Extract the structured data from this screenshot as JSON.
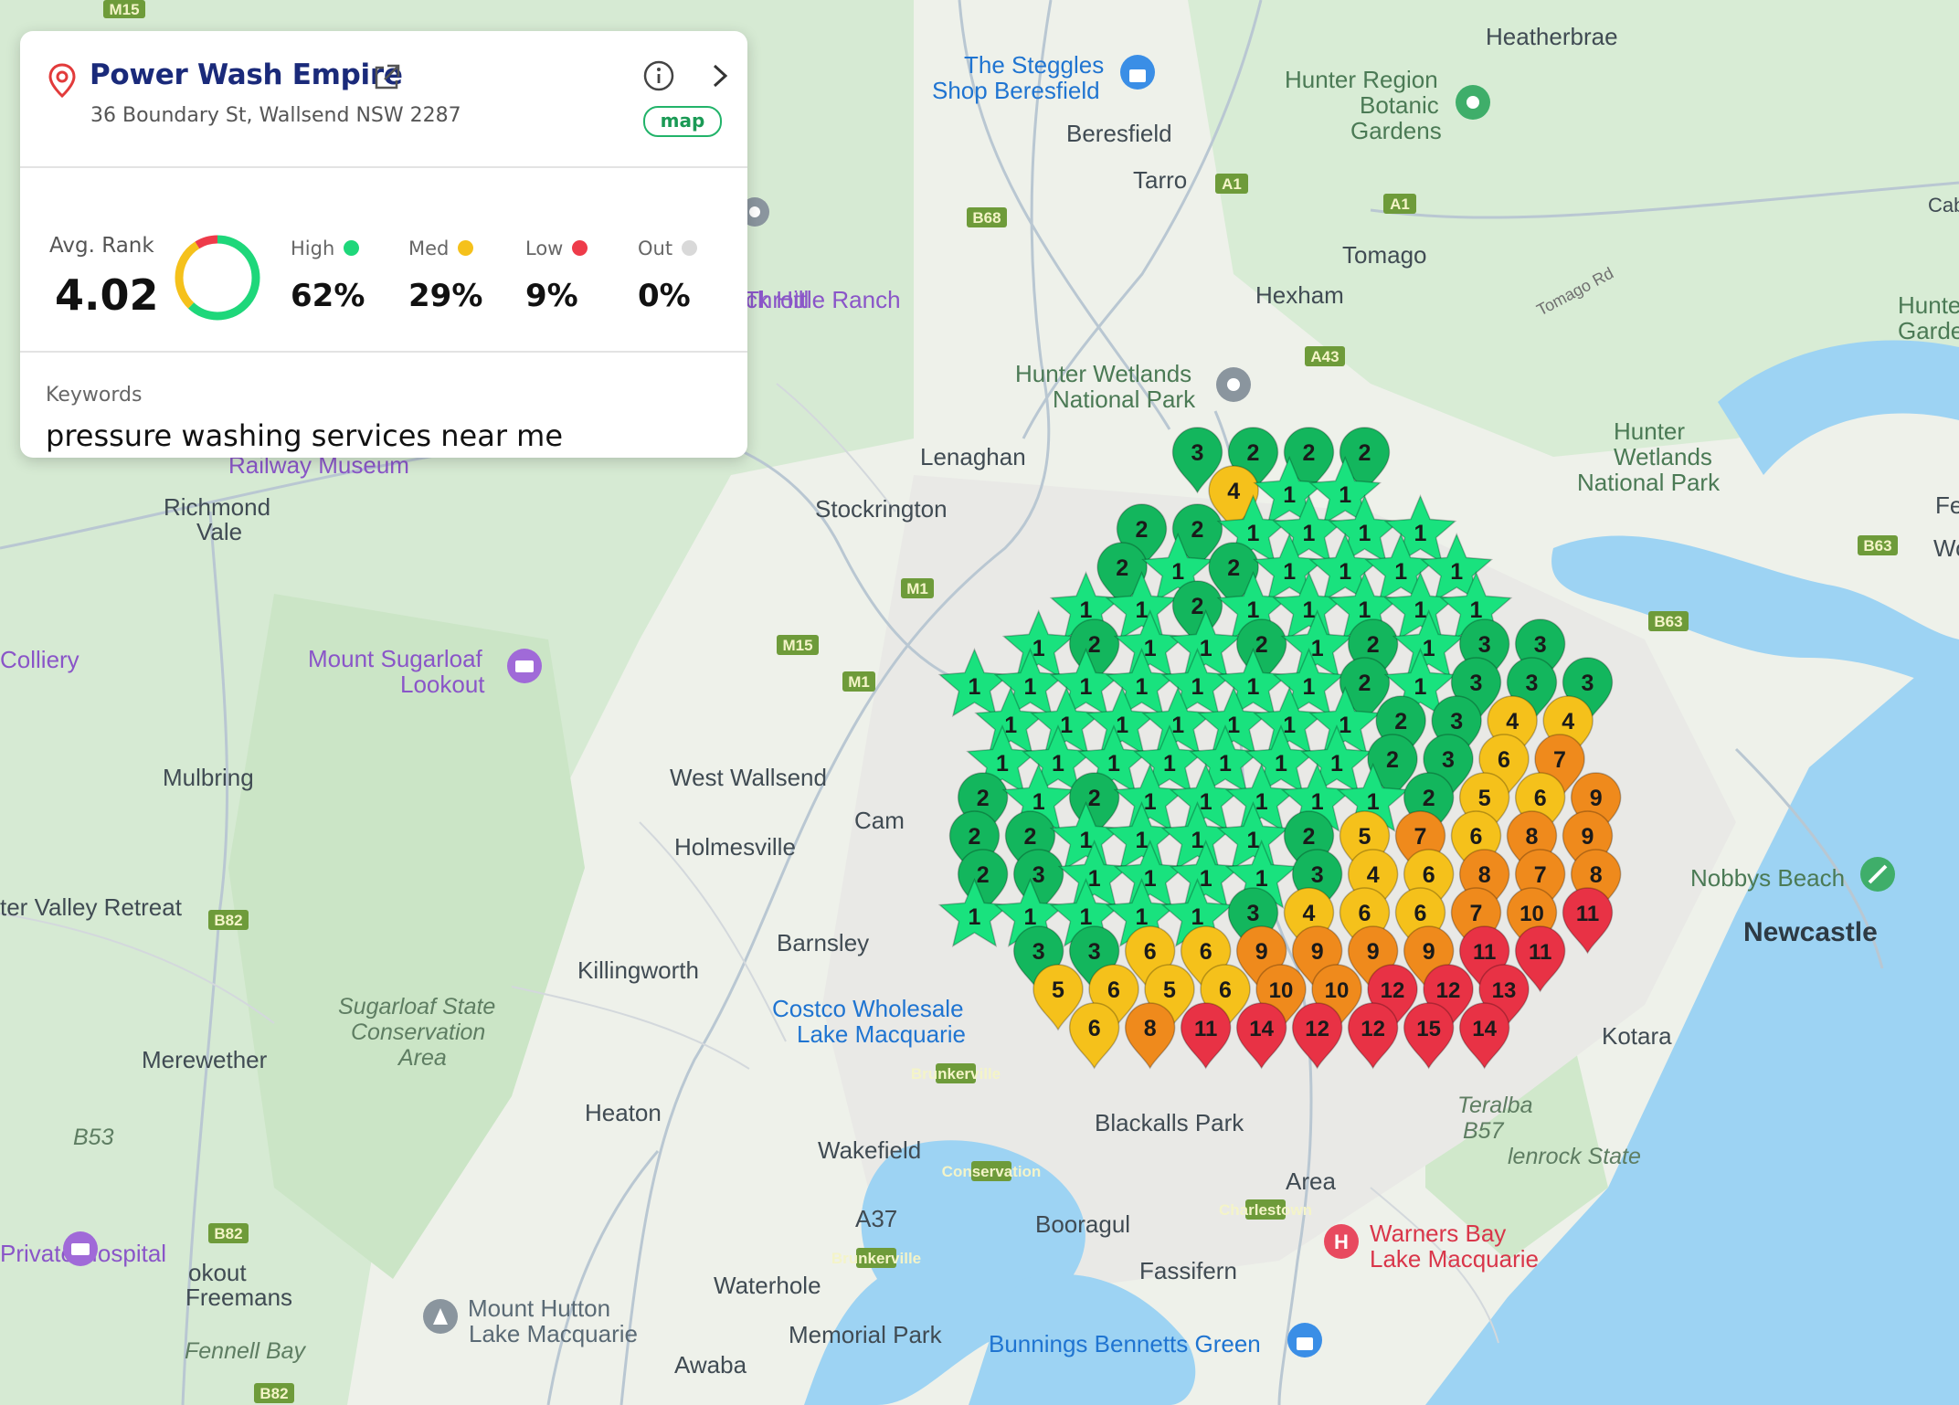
{
  "card": {
    "business_name": "Power Wash Empire",
    "address": "36 Boundary St, Wallsend NSW 2287",
    "map_badge": "map",
    "avg_rank_label": "Avg. Rank",
    "avg_rank_value": "4.02",
    "stats": [
      {
        "label": "High",
        "value": "62%",
        "color": "#1ed77a",
        "fraction": 0.62
      },
      {
        "label": "Med",
        "value": "29%",
        "color": "#f5c11b",
        "fraction": 0.29
      },
      {
        "label": "Low",
        "value": "9%",
        "color": "#ee3b4a",
        "fraction": 0.09
      },
      {
        "label": "Out",
        "value": "0%",
        "color": "#d9d9d9",
        "fraction": 0.0
      }
    ],
    "keywords_label": "Keywords",
    "keywords_value": "pressure washing services near me",
    "icons": [
      "location-pin-icon",
      "external-link-icon",
      "info-icon",
      "chevron-right-icon"
    ]
  },
  "map": {
    "places": [
      "M15",
      "The Steggles",
      "Shop Beresfield",
      "Heatherbrae",
      "Hunter Region",
      "Botanic",
      "Gardens",
      "Beresfield",
      "Tarro",
      "A1",
      "B68",
      "Cabbag",
      "Tomago",
      "Tomago Rd",
      "Hunte",
      "Garde",
      "ck Hill",
      "Throttle Ranch",
      "Hexham",
      "A43",
      "Hunter Wetlands",
      "National Park",
      "Lenaghan",
      "Railway Museum",
      "Richmond",
      "Vale",
      "Stockrington",
      "Hunter",
      "Wetlands",
      "National Park",
      "Fe",
      "Wo",
      "B63",
      "M1",
      "Colliery",
      "Mount Sugarloaf",
      "Lookout",
      "Mulbring",
      "West Wallsend",
      "Cam",
      "Holmesville",
      "Nobbys Beach",
      "Newcastle",
      "ter Valley Retreat",
      "B82",
      "Barnsley",
      "Killingworth",
      "Sugarloaf State",
      "Conservation",
      "Area",
      "Costco Wholesale",
      "Lake Macquarie",
      "Kotara",
      "Merewether",
      "Brunkerville",
      "B53",
      "Heaton",
      "Wakefield",
      "Teralba",
      "B57",
      "lenrock State",
      "Conservation",
      "Area",
      "Charlestown",
      "A37",
      "Booragul",
      "Warners Bay",
      "Lake Macquarie",
      "Private Hospital",
      "okout",
      "Freemans",
      "Waterhole",
      "Fassifern",
      "Mount Hutton",
      "Lake Macquarie",
      "Memorial Park",
      "Fennell Bay",
      "Bunnings Bennetts Green",
      "Awaba",
      "Blackalls Park",
      "Cha"
    ]
  },
  "chart_data": {
    "type": "map-grid",
    "legend": [
      {
        "label": "High",
        "color": "#1ed77a"
      },
      {
        "label": "Med",
        "color": "#f5c11b"
      },
      {
        "label": "Low",
        "color": "#ee3b4a"
      },
      {
        "label": "Out",
        "color": "#d9d9d9"
      }
    ],
    "rank_colors": {
      "1": "#19e27e",
      "2": "#13b65d",
      "3": "#13b65d",
      "4": "#f5c11b",
      "5": "#f5c11b",
      "6": "#f5c11b",
      "7": "#ef8a1c",
      "8": "#ef8a1c",
      "9": "#ef8a1c",
      "10": "#ef8a1c",
      "11": "#e83245",
      "12": "#e83245",
      "13": "#e83245",
      "14": "#e83245",
      "15": "#e83245"
    },
    "ranks": [
      [
        3,
        2,
        2,
        2
      ],
      [
        4,
        1,
        1
      ],
      [
        2,
        2,
        1,
        1,
        1,
        1
      ],
      [
        2,
        1,
        2,
        1,
        1,
        1,
        1
      ],
      [
        1,
        1,
        2,
        1,
        1,
        1,
        1,
        1
      ],
      [
        1,
        2,
        1,
        1,
        2,
        1,
        2,
        1,
        3,
        3
      ],
      [
        1,
        1,
        1,
        1,
        1,
        1,
        1,
        2,
        1,
        3,
        3,
        3
      ],
      [
        1,
        1,
        1,
        1,
        1,
        1,
        1,
        2,
        3,
        4,
        4
      ],
      [
        1,
        1,
        1,
        1,
        1,
        1,
        1,
        2,
        3,
        6,
        7
      ],
      [
        2,
        1,
        2,
        1,
        1,
        1,
        1,
        1,
        2,
        5,
        6,
        9
      ],
      [
        2,
        2,
        1,
        1,
        1,
        1,
        2,
        5,
        7,
        6,
        8,
        9
      ],
      [
        2,
        3,
        1,
        1,
        1,
        1,
        3,
        4,
        6,
        8,
        7,
        8
      ],
      [
        1,
        1,
        1,
        1,
        1,
        3,
        4,
        6,
        6,
        7,
        10,
        11
      ],
      [
        3,
        3,
        6,
        6,
        9,
        9,
        9,
        9,
        11,
        11
      ],
      [
        5,
        6,
        5,
        6,
        10,
        10,
        12,
        12,
        13
      ],
      [
        6,
        8,
        11,
        14,
        12,
        12,
        15,
        14
      ]
    ]
  }
}
